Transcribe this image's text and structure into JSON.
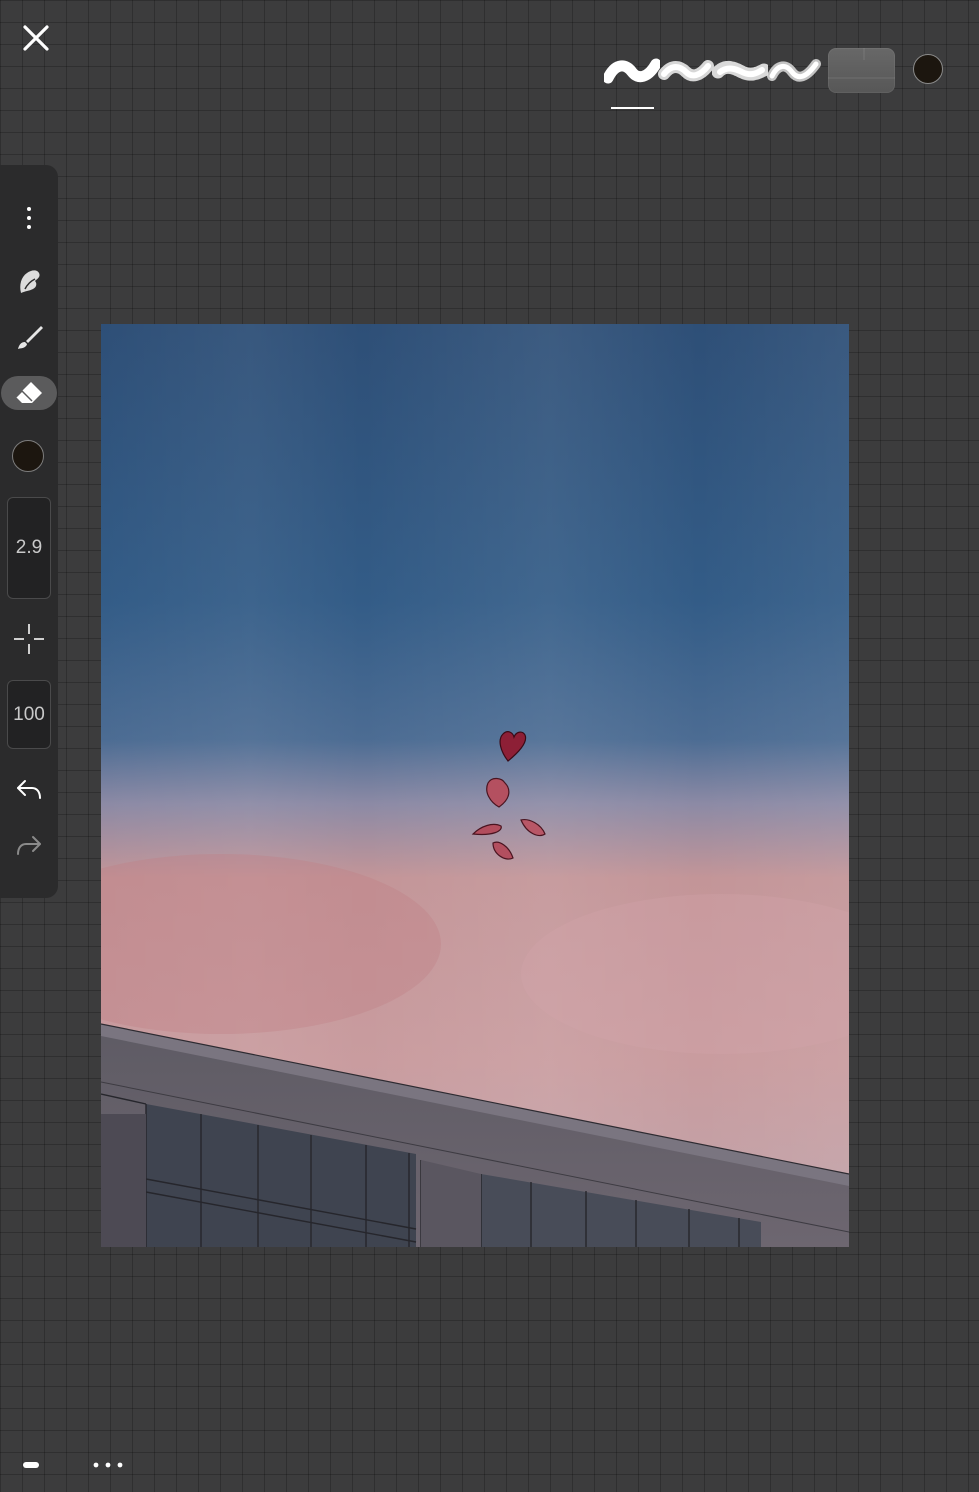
{
  "toolbar": {
    "close_icon": "close-icon",
    "brushes": [
      "brush-preset-1",
      "brush-preset-2",
      "brush-preset-3",
      "brush-preset-4"
    ],
    "selected_brush_index": 0,
    "texture_swatch": "texture-swatch",
    "current_color": "#1c160f"
  },
  "sidebar": {
    "more_icon": "vertical-dots-icon",
    "smudge_icon": "smudge-icon",
    "brush_icon": "brush-icon",
    "eraser_icon": "eraser-icon",
    "active_tool": "eraser",
    "color": "#1c160f",
    "size_value": "2.9",
    "crosshair_icon": "crosshair-icon",
    "opacity_value": "100",
    "undo_icon": "undo-icon",
    "redo_icon": "redo-icon"
  },
  "canvas": {
    "sky_colors": [
      "#2e5079",
      "#44668f",
      "#c99a9f",
      "#c59090"
    ],
    "building_color": "#54525b"
  },
  "bottom": {
    "handle_icon": "minus-handle-icon",
    "more_icon": "horizontal-dots-icon"
  }
}
